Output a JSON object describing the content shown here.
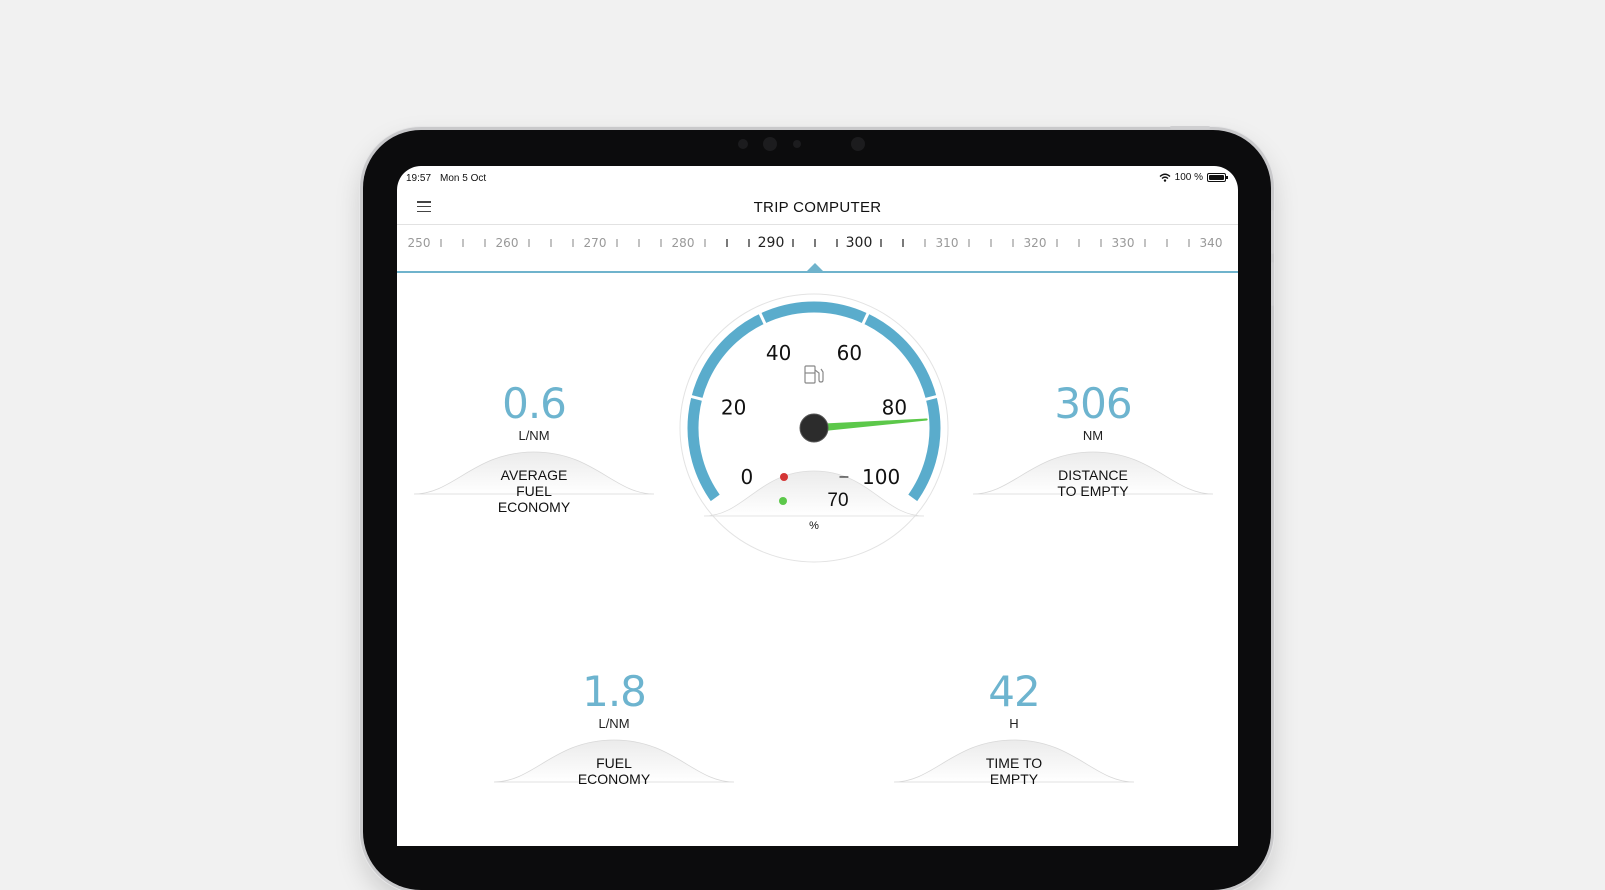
{
  "status_bar": {
    "time": "19:57",
    "date": "Mon 5 Oct",
    "battery": "100 %"
  },
  "header": {
    "title": "TRIP COMPUTER"
  },
  "ruler": {
    "labels": [
      "250",
      "260",
      "270",
      "280",
      "290",
      "300",
      "310",
      "320",
      "330",
      "340"
    ],
    "min": 250,
    "max": 340,
    "current": 295
  },
  "metrics": {
    "average_fuel_economy": {
      "value": "0.6",
      "unit": "L/NM",
      "label": "AVERAGE\nFUEL\nECONOMY"
    },
    "distance_to_empty": {
      "value": "306",
      "unit": "NM",
      "label": "DISTANCE\nTO EMPTY"
    },
    "fuel_economy": {
      "value": "1.8",
      "unit": "L/NM",
      "label": "FUEL\nECONOMY"
    },
    "time_to_empty": {
      "value": "42",
      "unit": "H",
      "label": "TIME TO\nEMPTY"
    }
  },
  "fuel_gauge": {
    "tick_labels": [
      "0",
      "20",
      "40",
      "60",
      "80",
      "100"
    ],
    "value": 84,
    "readout_red": "–",
    "readout_green": "70",
    "unit": "%",
    "colors": {
      "arc": "#5aaccc",
      "needle": "#5cc84a",
      "red_dot": "#d43535",
      "green_dot": "#5cc84a"
    }
  }
}
